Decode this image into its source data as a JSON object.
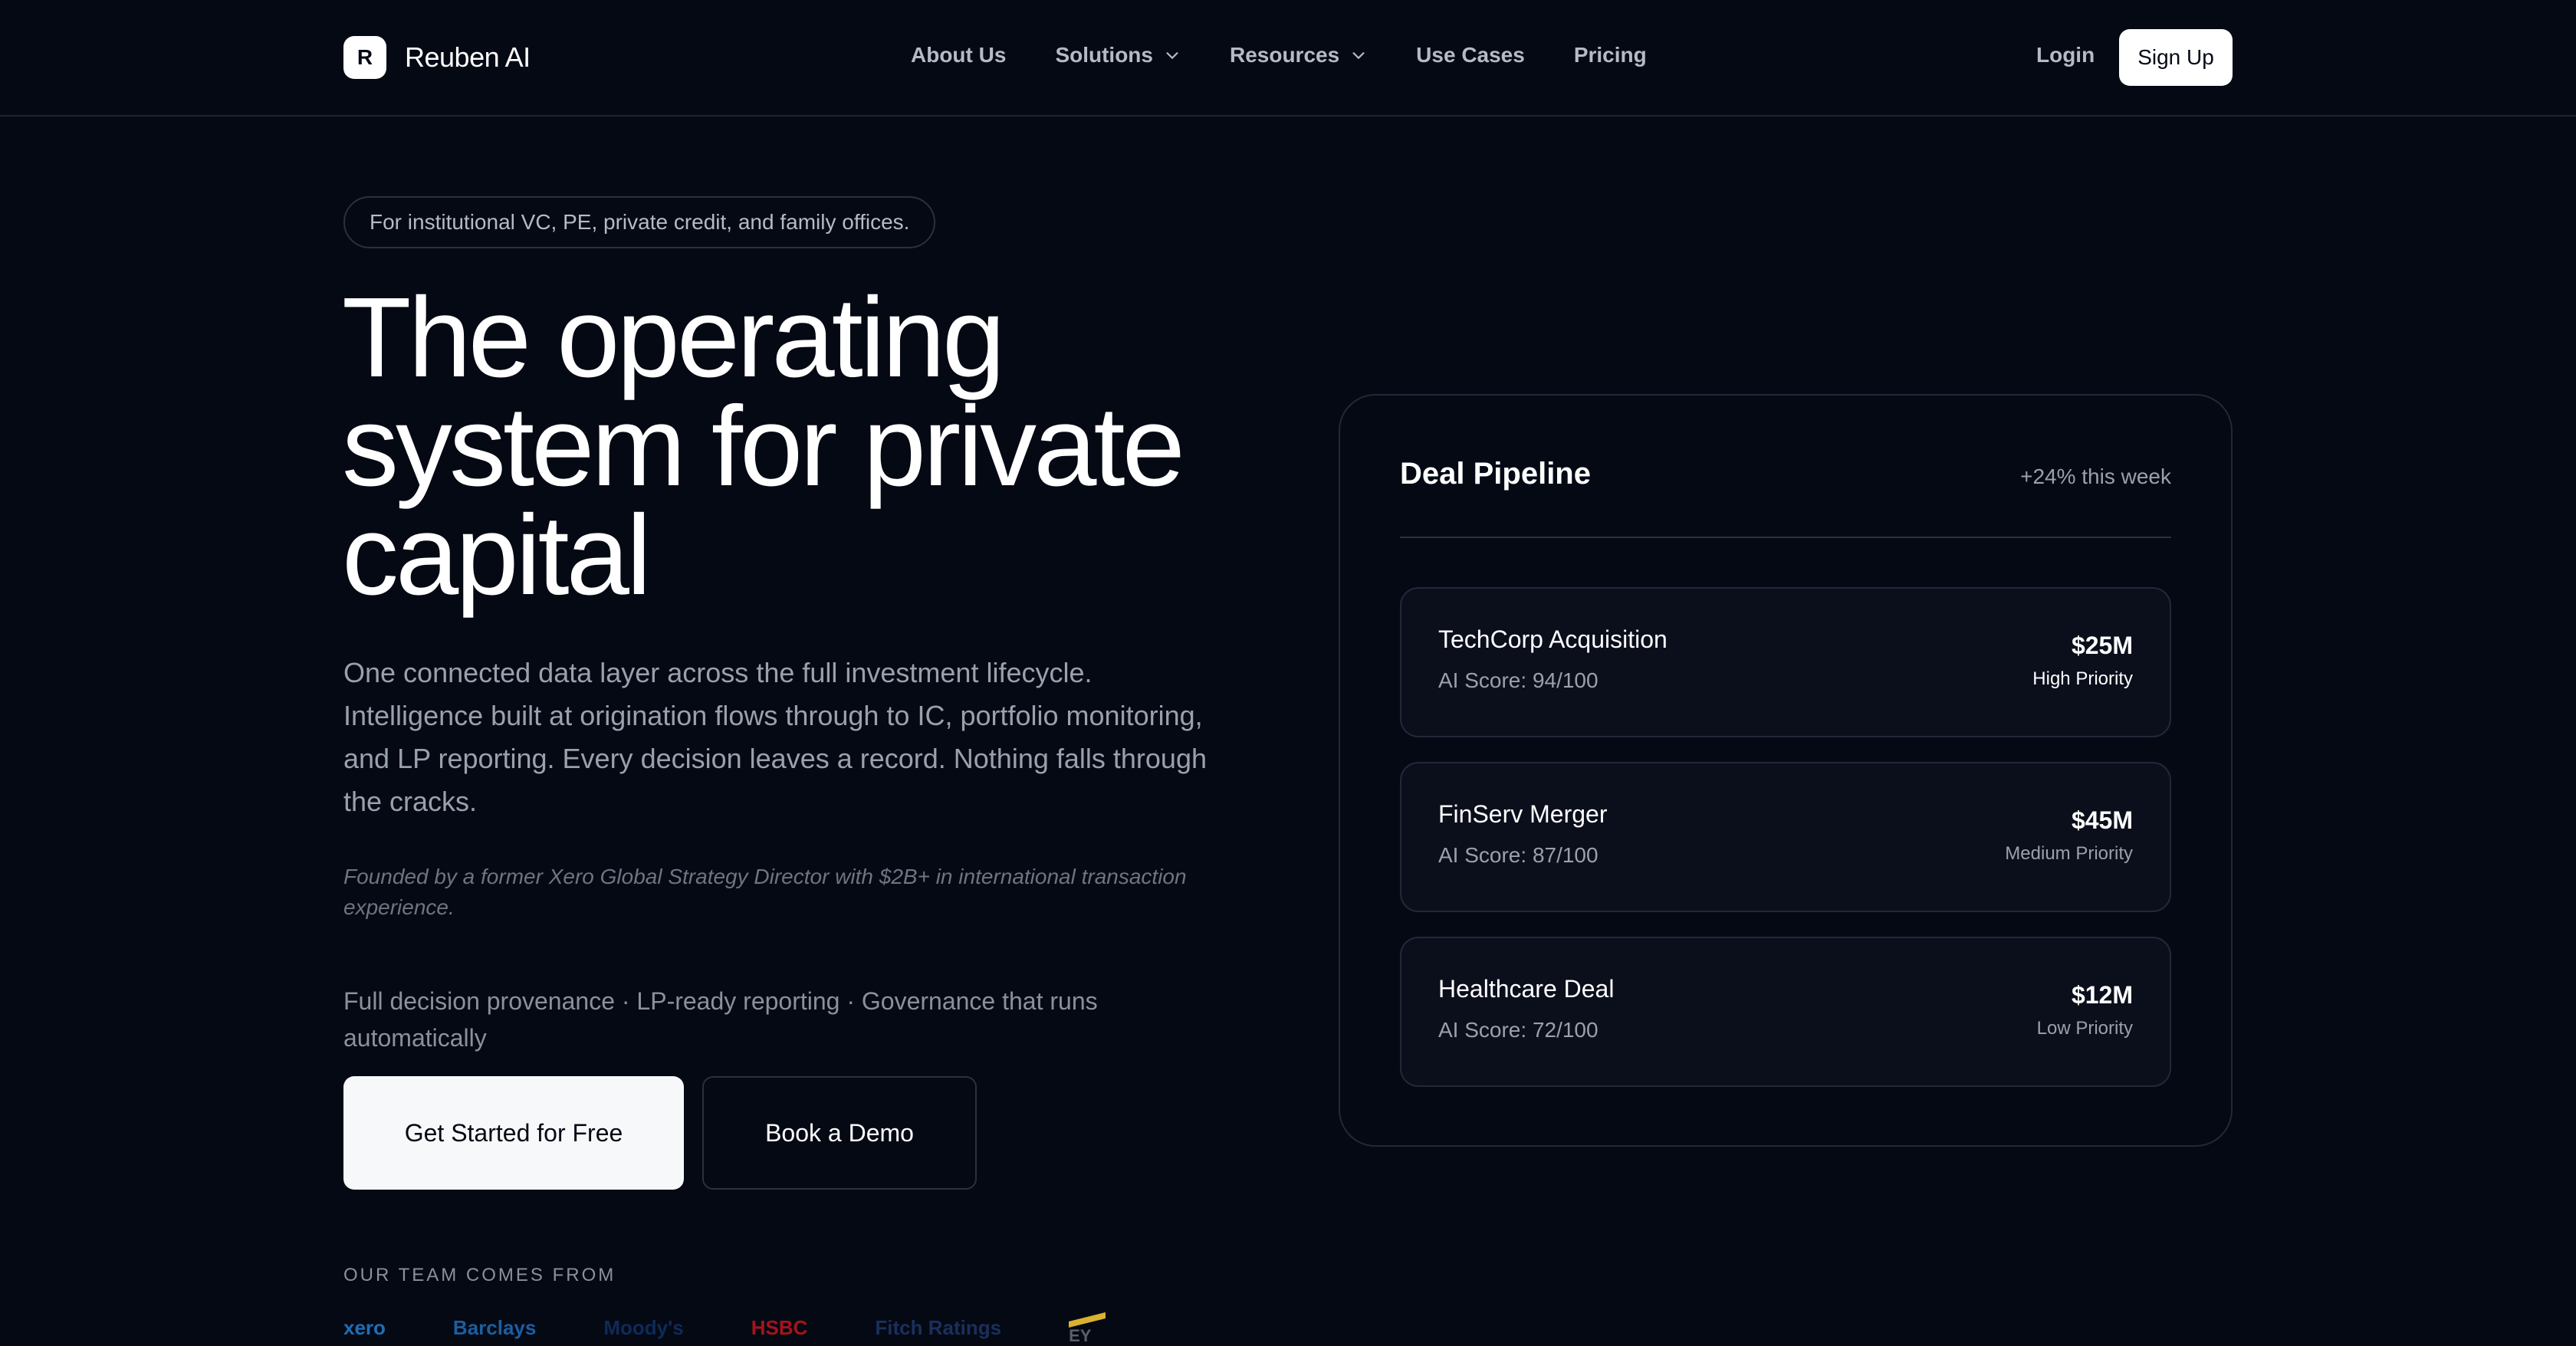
{
  "nav": {
    "brand_mark": "R",
    "brand_name": "Reuben AI",
    "links": [
      {
        "label": "About Us"
      },
      {
        "label": "Solutions"
      },
      {
        "label": "Resources"
      },
      {
        "label": "Use Cases"
      },
      {
        "label": "Pricing"
      }
    ],
    "login": "Login",
    "signup": "Sign Up"
  },
  "hero": {
    "pill": "For institutional VC, PE, private credit, and family offices.",
    "title": "The operating system for private capital",
    "description": "One connected data layer across the full investment lifecycle. Intelligence built at origination flows through to IC, portfolio monitoring, and LP reporting. Every decision leaves a record. Nothing falls through the cracks.",
    "founder": "Founded by a former Xero Global Strategy Director with $2B+ in international transaction experience.",
    "tagline": "Full decision provenance · LP-ready reporting · Governance that runs automatically",
    "cta_primary": "Get Started for Free",
    "cta_secondary": "Book a Demo",
    "team_label": "OUR TEAM COMES FROM",
    "logos": [
      {
        "name": "xero",
        "color": "#1d6fb8"
      },
      {
        "name": "Barclays",
        "color": "#1b5fa0"
      },
      {
        "name": "Moody's",
        "color": "#0e2a5a"
      },
      {
        "name": "HSBC",
        "color": "#a3141b"
      },
      {
        "name": "Fitch Ratings",
        "color": "#1b2f5c"
      },
      {
        "name": "EY",
        "color": "#5a5f6a"
      }
    ]
  },
  "pipeline": {
    "title": "Deal Pipeline",
    "growth": "+24% this week",
    "deals": [
      {
        "name": "TechCorp Acquisition",
        "score": "AI Score: 94/100",
        "amount": "$25M",
        "priority": "High Priority",
        "priority_color": "#ffffff"
      },
      {
        "name": "FinServ Merger",
        "score": "AI Score: 87/100",
        "amount": "$45M",
        "priority": "Medium Priority",
        "priority_color": "#9aa0ad"
      },
      {
        "name": "Healthcare Deal",
        "score": "AI Score: 72/100",
        "amount": "$12M",
        "priority": "Low Priority",
        "priority_color": "#9aa0ad"
      }
    ]
  },
  "colors": {
    "background": "#050914",
    "accent": "#ffffff",
    "muted_text": "#9aa0ad"
  }
}
